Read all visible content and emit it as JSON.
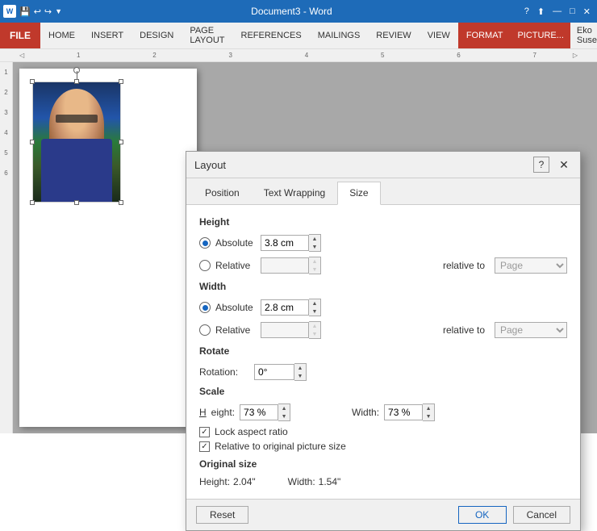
{
  "titlebar": {
    "title": "Document3 - Word",
    "help_btn": "?",
    "minimize_btn": "—",
    "maximize_btn": "□",
    "close_btn": "✕"
  },
  "ribbon": {
    "picture_label": "PICTURE...",
    "tabs": [
      "FILE",
      "HOME",
      "INSERT",
      "DESIGN",
      "PAGE LAYOUT",
      "REFERENCES",
      "MAILINGS",
      "REVIEW",
      "VIEW",
      "FORMAT"
    ],
    "active_tab": "FORMAT",
    "user_name": "Eko Suseno"
  },
  "dialog": {
    "title": "Layout",
    "help_label": "?",
    "close_label": "✕",
    "tabs": [
      "Position",
      "Text Wrapping",
      "Size"
    ],
    "active_tab": "Size",
    "sections": {
      "height": {
        "label": "Height",
        "absolute_label": "Absolute",
        "absolute_value": "3.8 cm",
        "relative_label": "Relative",
        "relative_value": "",
        "relative_to_label": "relative to",
        "relative_to_value": "Page"
      },
      "width": {
        "label": "Width",
        "absolute_label": "Absolute",
        "absolute_value": "2.8 cm",
        "relative_label": "Relative",
        "relative_value": "",
        "relative_to_label": "relative to",
        "relative_to_value": "Page"
      },
      "rotate": {
        "label": "Rotate",
        "rotation_label": "Rotation:",
        "rotation_value": "0°"
      },
      "scale": {
        "label": "Scale",
        "height_label": "Height:",
        "height_value": "73 %",
        "width_label": "Width:",
        "width_value": "73 %",
        "lock_aspect_label": "Lock aspect ratio",
        "relative_original_label": "Relative to original picture size"
      },
      "original_size": {
        "label": "Original size",
        "height_label": "Height:",
        "height_value": "2.04\"",
        "width_label": "Width:",
        "width_value": "1.54\""
      }
    },
    "footer": {
      "reset_label": "Reset",
      "ok_label": "OK",
      "cancel_label": "Cancel"
    }
  }
}
